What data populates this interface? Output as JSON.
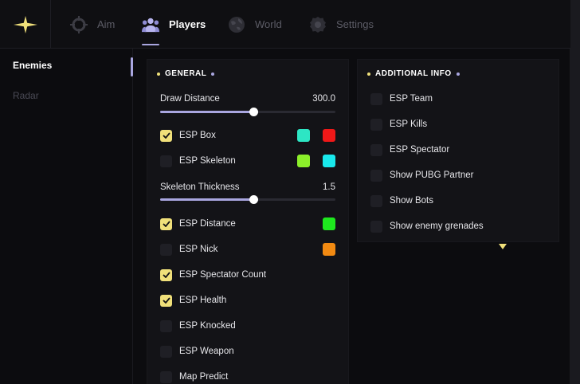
{
  "nav": {
    "tabs": [
      {
        "label": "Aim",
        "icon": "crosshair-icon",
        "active": false
      },
      {
        "label": "Players",
        "icon": "people-icon",
        "active": true
      },
      {
        "label": "World",
        "icon": "globe-icon",
        "active": false
      },
      {
        "label": "Settings",
        "icon": "gear-icon",
        "active": false
      }
    ]
  },
  "sidebar": {
    "items": [
      {
        "label": "Enemies",
        "active": true
      },
      {
        "label": "Radar",
        "active": false
      }
    ]
  },
  "general": {
    "title": "GENERAL",
    "draw_distance": {
      "label": "Draw Distance",
      "value": "300.0",
      "fraction": 0.53
    },
    "esp_box": {
      "label": "ESP Box",
      "checked": true,
      "colors": [
        "#2de6c4",
        "#f01818"
      ]
    },
    "esp_skeleton": {
      "label": "ESP Skeleton",
      "checked": false,
      "colors": [
        "#8cf02a",
        "#19e9ec"
      ]
    },
    "skeleton_thickness": {
      "label": "Skeleton Thickness",
      "value": "1.5",
      "fraction": 0.53
    },
    "esp_distance": {
      "label": "ESP Distance",
      "checked": true,
      "colors": [
        "#1ee81e"
      ]
    },
    "esp_nick": {
      "label": "ESP Nick",
      "checked": false,
      "colors": [
        "#f28a12"
      ]
    },
    "esp_spectator_count": {
      "label": "ESP Spectator Count",
      "checked": true
    },
    "esp_health": {
      "label": "ESP Health",
      "checked": true
    },
    "esp_knocked": {
      "label": "ESP Knocked",
      "checked": false
    },
    "esp_weapon": {
      "label": "ESP Weapon",
      "checked": false
    },
    "map_predict": {
      "label": "Map Predict",
      "checked": false
    }
  },
  "additional": {
    "title": "ADDITIONAL INFO",
    "items": [
      {
        "label": "ESP Team",
        "checked": false
      },
      {
        "label": "ESP Kills",
        "checked": false
      },
      {
        "label": "ESP Spectator",
        "checked": false
      },
      {
        "label": "Show PUBG Partner",
        "checked": false
      },
      {
        "label": "Show Bots",
        "checked": false
      },
      {
        "label": "Show enemy grenades",
        "checked": false
      }
    ]
  },
  "colors": {
    "accent_yellow": "#f0e07a",
    "accent_purple": "#a9a6e0"
  }
}
